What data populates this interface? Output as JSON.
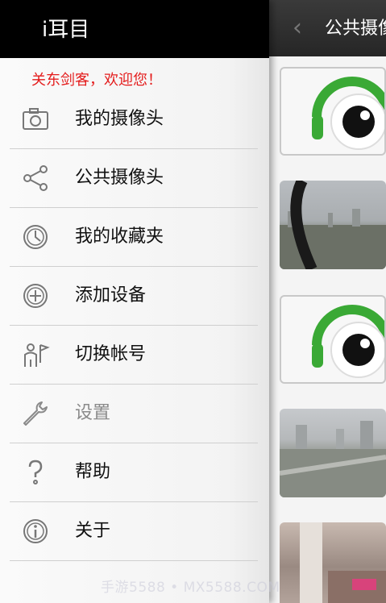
{
  "drawer": {
    "app_title": "i耳目",
    "welcome": "关东剑客，欢迎您！",
    "items": [
      {
        "label": "我的摄像头",
        "icon": "camera-icon",
        "enabled": true
      },
      {
        "label": "公共摄像头",
        "icon": "share-icon",
        "enabled": true
      },
      {
        "label": "我的收藏夹",
        "icon": "clock-icon",
        "enabled": true
      },
      {
        "label": "添加设备",
        "icon": "plus-circle-icon",
        "enabled": true
      },
      {
        "label": "切换帐号",
        "icon": "user-switch-icon",
        "enabled": true
      },
      {
        "label": "设置",
        "icon": "wrench-icon",
        "enabled": false
      },
      {
        "label": "帮助",
        "icon": "question-icon",
        "enabled": true
      },
      {
        "label": "关于",
        "icon": "info-icon",
        "enabled": true
      }
    ]
  },
  "background": {
    "title": "公共摄像头"
  },
  "watermark": "手游5588 • MX5588.COM",
  "colors": {
    "welcome": "#e41b1b",
    "logo_green": "#3aa935"
  }
}
